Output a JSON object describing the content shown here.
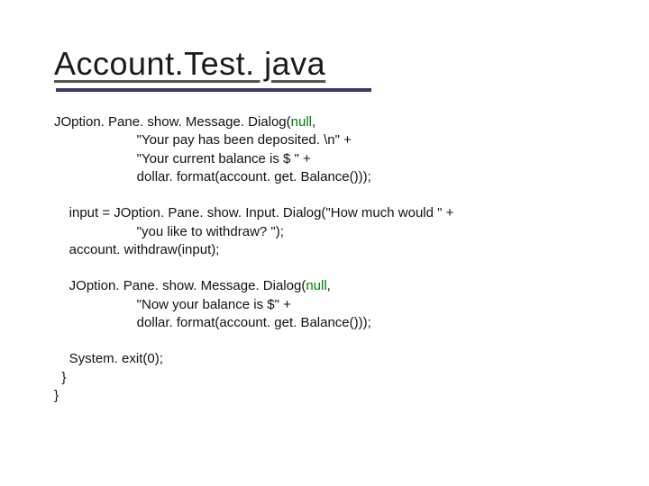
{
  "title": "Account.Test. java",
  "code": {
    "l1a": "JOption. Pane. show. Message. Dialog(",
    "l1_null": "null",
    "l1b": ",",
    "l2": "                      \"Your pay has been deposited. \\n\" +",
    "l3": "                      \"Your current balance is $ \" +",
    "l4": "                      dollar. format(account. get. Balance()));",
    "l5": "",
    "l6": "    input = JOption. Pane. show. Input. Dialog(\"How much would \" +",
    "l7": "                      \"you like to withdraw? \");",
    "l8": "    account. withdraw(input);",
    "l9": "",
    "l10a": "    JOption. Pane. show. Message. Dialog(",
    "l10_null": "null",
    "l10b": ",",
    "l11": "                      \"Now your balance is $\" +",
    "l12": "                      dollar. format(account. get. Balance()));",
    "l13": "",
    "l14": "    System. exit(0);",
    "l15": "  }",
    "l16": "}"
  }
}
